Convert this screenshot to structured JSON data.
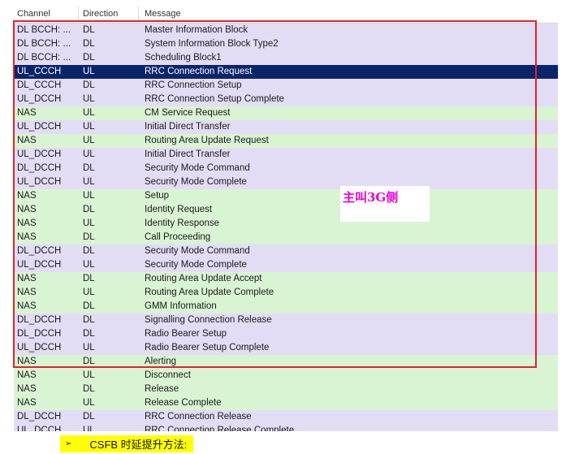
{
  "columns": {
    "channel": "Channel",
    "direction": "Direction",
    "message": "Message"
  },
  "rows": [
    {
      "channel": "DL BCCH: ...",
      "direction": "DL",
      "message": "Master Information Block",
      "style": "lav"
    },
    {
      "channel": "DL BCCH: ...",
      "direction": "DL",
      "message": "System Information Block Type2",
      "style": "lav"
    },
    {
      "channel": "DL BCCH: ...",
      "direction": "DL",
      "message": "Scheduling Block1",
      "style": "lav"
    },
    {
      "channel": "UL_CCCH",
      "direction": "UL",
      "message": "RRC Connection Request",
      "style": "sel"
    },
    {
      "channel": "DL_CCCH",
      "direction": "DL",
      "message": "RRC Connection Setup",
      "style": "lav"
    },
    {
      "channel": "UL_DCCH",
      "direction": "UL",
      "message": "RRC Connection Setup Complete",
      "style": "lav"
    },
    {
      "channel": "NAS",
      "direction": "UL",
      "message": "CM Service Request",
      "style": "grn"
    },
    {
      "channel": "UL_DCCH",
      "direction": "UL",
      "message": "Initial Direct Transfer",
      "style": "lav"
    },
    {
      "channel": "NAS",
      "direction": "UL",
      "message": "Routing Area Update Request",
      "style": "grn"
    },
    {
      "channel": "UL_DCCH",
      "direction": "UL",
      "message": "Initial Direct Transfer",
      "style": "lav"
    },
    {
      "channel": "DL_DCCH",
      "direction": "DL",
      "message": "Security Mode Command",
      "style": "lav"
    },
    {
      "channel": "UL_DCCH",
      "direction": "UL",
      "message": "Security Mode Complete",
      "style": "lav"
    },
    {
      "channel": "NAS",
      "direction": "UL",
      "message": "Setup",
      "style": "grn"
    },
    {
      "channel": "NAS",
      "direction": "DL",
      "message": "Identity Request",
      "style": "grn"
    },
    {
      "channel": "NAS",
      "direction": "UL",
      "message": "Identity Response",
      "style": "grn"
    },
    {
      "channel": "NAS",
      "direction": "DL",
      "message": "Call Proceeding",
      "style": "grn"
    },
    {
      "channel": "DL_DCCH",
      "direction": "DL",
      "message": "Security Mode Command",
      "style": "lav"
    },
    {
      "channel": "UL_DCCH",
      "direction": "UL",
      "message": "Security Mode Complete",
      "style": "lav"
    },
    {
      "channel": "NAS",
      "direction": "DL",
      "message": "Routing Area Update Accept",
      "style": "grn"
    },
    {
      "channel": "NAS",
      "direction": "UL",
      "message": "Routing Area Update Complete",
      "style": "grn"
    },
    {
      "channel": "NAS",
      "direction": "DL",
      "message": "GMM Information",
      "style": "grn"
    },
    {
      "channel": "DL_DCCH",
      "direction": "DL",
      "message": "Signalling Connection Release",
      "style": "lav"
    },
    {
      "channel": "DL_DCCH",
      "direction": "DL",
      "message": "Radio Bearer Setup",
      "style": "lav"
    },
    {
      "channel": "UL_DCCH",
      "direction": "UL",
      "message": "Radio Bearer Setup Complete",
      "style": "lav"
    },
    {
      "channel": "NAS",
      "direction": "DL",
      "message": "Alerting",
      "style": "grn"
    },
    {
      "channel": "NAS",
      "direction": "UL",
      "message": "Disconnect",
      "style": "grn"
    },
    {
      "channel": "NAS",
      "direction": "DL",
      "message": "Release",
      "style": "grn"
    },
    {
      "channel": "NAS",
      "direction": "UL",
      "message": "Release Complete",
      "style": "grn"
    },
    {
      "channel": "DL_DCCH",
      "direction": "DL",
      "message": "RRC Connection Release",
      "style": "lav"
    },
    {
      "channel": "UL_DCCH",
      "direction": "UL",
      "message": "RRC Connection Release Complete",
      "style": "lav"
    }
  ],
  "annotation": {
    "label": "主叫3G侧",
    "color": "#e600d6",
    "box_color": "#e8202a"
  },
  "bullet": {
    "icon": "arrow-bullet-icon",
    "arrow_glyph": "➢",
    "text": "CSFB 时延提升方法:"
  },
  "colors": {
    "selected": "#0a246a",
    "lavender": "#e3dcf5",
    "green": "#d9f4d3",
    "highlight": "#ffff00"
  }
}
